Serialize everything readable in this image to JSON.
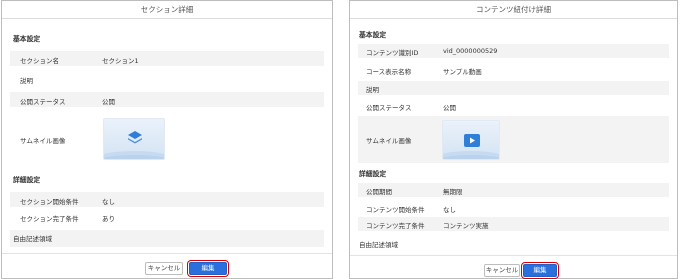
{
  "left": {
    "title": "セクション詳細",
    "basic_heading": "基本設定",
    "section_name_label": "セクション名",
    "section_name_value": "セクション1",
    "description_label": "説明",
    "status_label": "公開ステータス",
    "status_value": "公開",
    "thumbnail_label": "サムネイル画像",
    "thumbnail_icon": "layers-icon",
    "detail_heading": "詳細設定",
    "start_cond_label": "セクション開始条件",
    "start_cond_value": "なし",
    "complete_cond_label": "セクション完了条件",
    "complete_cond_value": "あり",
    "free_text_label": "自由記述領域",
    "cancel_label": "キャンセル",
    "edit_label": "編集"
  },
  "right": {
    "title": "コンテンツ紐付け詳細",
    "basic_heading": "基本設定",
    "content_id_label": "コンテンツ識別ID",
    "content_id_value": "vid_0000000529",
    "course_display_label": "コース表示名称",
    "course_display_value": "サンプル動画",
    "description_label": "説明",
    "status_label": "公開ステータス",
    "status_value": "公開",
    "thumbnail_label": "サムネイル画像",
    "thumbnail_icon": "play-icon",
    "detail_heading": "詳細設定",
    "period_label": "公開期間",
    "period_value": "無期限",
    "start_cond_label": "コンテンツ開始条件",
    "start_cond_value": "なし",
    "complete_cond_label": "コンテンツ完了条件",
    "complete_cond_value": "コンテンツ実施",
    "free_text_label": "自由記述領域",
    "cancel_label": "キャンセル",
    "edit_label": "編集"
  },
  "colors": {
    "primary": "#2b6fdc",
    "highlight": "#d60000",
    "row_shade": "#f3f3f3"
  }
}
